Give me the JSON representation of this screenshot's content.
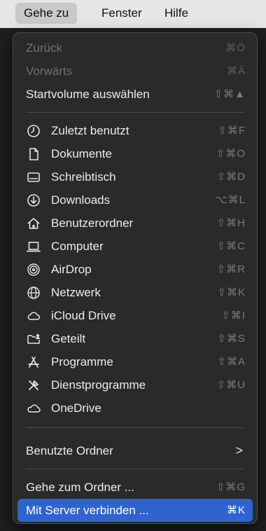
{
  "menubar": {
    "items": [
      "Gehe zu",
      "Fenster",
      "Hilfe"
    ]
  },
  "menu": {
    "nav": [
      {
        "label": "Zurück",
        "shortcut": "⌘Ö",
        "enabled": false
      },
      {
        "label": "Vorwärts",
        "shortcut": "⌘Ä",
        "enabled": false
      },
      {
        "label": "Startvolume auswählen",
        "shortcut": "⇧⌘▲",
        "enabled": true
      }
    ],
    "places": [
      {
        "label": "Zuletzt benutzt",
        "shortcut": "⇧⌘F",
        "icon": "clock-icon"
      },
      {
        "label": "Dokumente",
        "shortcut": "⇧⌘O",
        "icon": "document-icon"
      },
      {
        "label": "Schreibtisch",
        "shortcut": "⇧⌘D",
        "icon": "desktop-icon"
      },
      {
        "label": "Downloads",
        "shortcut": "⌥⌘L",
        "icon": "download-icon"
      },
      {
        "label": "Benutzerordner",
        "shortcut": "⇧⌘H",
        "icon": "home-icon"
      },
      {
        "label": "Computer",
        "shortcut": "⇧⌘C",
        "icon": "computer-icon"
      },
      {
        "label": "AirDrop",
        "shortcut": "⇧⌘R",
        "icon": "airdrop-icon"
      },
      {
        "label": "Netzwerk",
        "shortcut": "⇧⌘K",
        "icon": "network-icon"
      },
      {
        "label": "iCloud Drive",
        "shortcut": "⇧⌘I",
        "icon": "cloud-icon"
      },
      {
        "label": "Geteilt",
        "shortcut": "⇧⌘S",
        "icon": "shared-folder-icon"
      },
      {
        "label": "Programme",
        "shortcut": "⇧⌘A",
        "icon": "applications-icon"
      },
      {
        "label": "Dienstprogramme",
        "shortcut": "⇧⌘U",
        "icon": "utilities-icon"
      },
      {
        "label": "OneDrive",
        "shortcut": "",
        "icon": "onedrive-cloud-icon"
      }
    ],
    "recent_folders": {
      "label": "Benutzte Ordner",
      "chevron": ">"
    },
    "goto_folder": {
      "label": "Gehe zum Ordner ...",
      "shortcut": "⇧⌘G"
    },
    "connect_server": {
      "label": "Mit Server verbinden ...",
      "shortcut": "⌘K",
      "highlighted": true
    }
  }
}
